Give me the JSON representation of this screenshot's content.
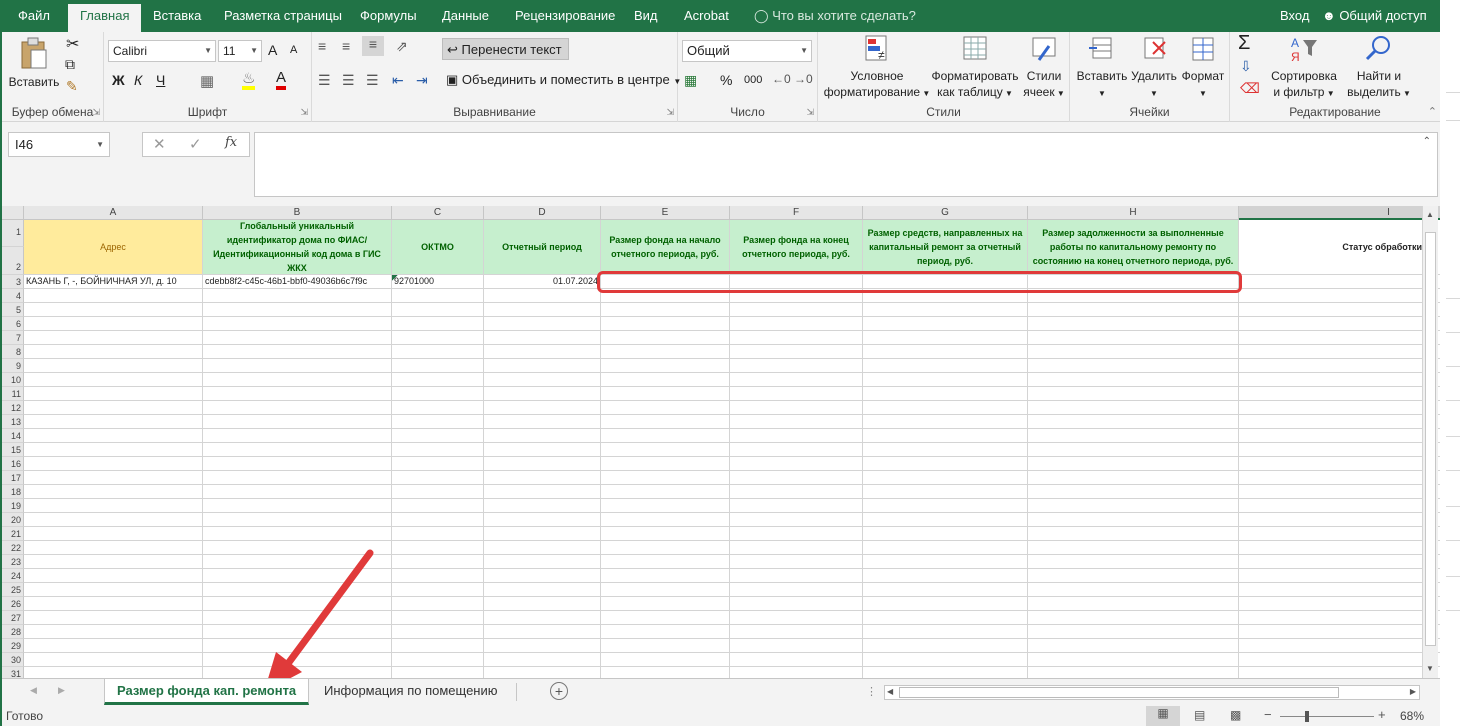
{
  "menu": {
    "tabs": [
      "Файл",
      "Главная",
      "Вставка",
      "Разметка страницы",
      "Формулы",
      "Данные",
      "Рецензирование",
      "Вид",
      "Acrobat"
    ],
    "active_tab": "Главная",
    "tell_me": "Что вы хотите сделать?",
    "login": "Вход",
    "share": "Общий доступ"
  },
  "ribbon": {
    "clipboard": {
      "paste": "Вставить",
      "label": "Буфер обмена"
    },
    "font": {
      "name": "Calibri",
      "size": "11",
      "bold": "Ж",
      "italic": "К",
      "underline": "Ч",
      "grow": "A",
      "shrink": "A",
      "color_glyph": "A",
      "label": "Шрифт"
    },
    "alignment": {
      "wrap": "Перенести текст",
      "merge": "Объединить и поместить в центре",
      "label": "Выравнивание"
    },
    "number": {
      "format": "Общий",
      "percent": "%",
      "thousands": "000",
      "label": "Число"
    },
    "styles": {
      "conditional": [
        "Условное",
        "форматирование"
      ],
      "table": [
        "Форматировать",
        "как таблицу"
      ],
      "cell": [
        "Стили",
        "ячеек"
      ],
      "label": "Стили"
    },
    "cells": {
      "insert": "Вставить",
      "delete": "Удалить",
      "format": "Формат",
      "label": "Ячейки"
    },
    "editing": {
      "sort": [
        "Сортировка",
        "и фильтр"
      ],
      "find": [
        "Найти и",
        "выделить"
      ],
      "label": "Редактирование"
    }
  },
  "formula_bar": {
    "name_box": "I46",
    "fx": "fx",
    "value": ""
  },
  "columns": [
    "A",
    "B",
    "C",
    "D",
    "E",
    "F",
    "G",
    "H",
    "I"
  ],
  "header_row": {
    "A": "Адрес",
    "B": "Глобальный уникальный идентификатор дома по ФИАС/Идентификационный код дома в ГИС ЖКХ",
    "C": "ОКТМО",
    "D": "Отчетный период",
    "E": "Размер фонда на начало отчетного периода, руб.",
    "F": "Размер фонда на конец отчетного периода, руб.",
    "G": "Размер средств, направленных на капитальный ремонт за отчетный период, руб.",
    "H": "Размер задолженности за выполненные работы по капитальному ремонту по состоянию на конец отчетного периода, руб.",
    "I": "Статус обработки"
  },
  "data_row": {
    "A": "КАЗАНЬ Г, -, БОЙНИЧНАЯ УЛ, д. 10",
    "B": "cdebb8f2-c45c-46b1-bbf0-49036b6c7f9c",
    "C": "92701000",
    "D": "01.07.2024"
  },
  "row_numbers": [
    "1",
    "2",
    "3",
    "4",
    "5",
    "6",
    "7",
    "8",
    "9",
    "10",
    "11",
    "12",
    "13",
    "14",
    "15",
    "16",
    "17",
    "18",
    "19",
    "20",
    "21",
    "22",
    "23",
    "24",
    "25",
    "26",
    "27",
    "28",
    "29",
    "30",
    "31"
  ],
  "sheets": [
    "Размер фонда кап. ремонта",
    "Информация по помещению"
  ],
  "active_sheet": "Размер фонда кап. ремонта",
  "status": {
    "ready": "Готово",
    "zoom": "68%"
  },
  "colors": {
    "accent": "#217346",
    "header_green": "#c6efce",
    "header_yellow": "#ffeb9c",
    "highlight": "#e03a3a"
  }
}
